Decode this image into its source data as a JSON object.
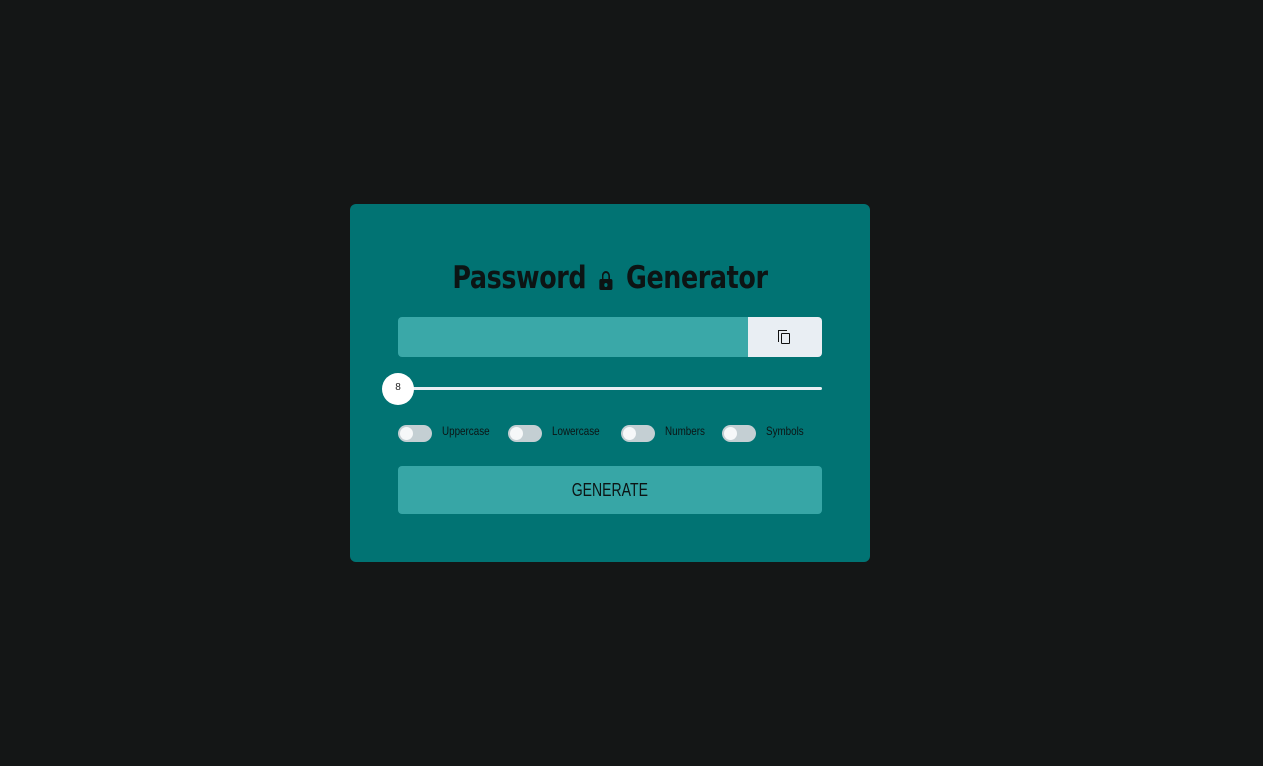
{
  "title": {
    "word1": "Password",
    "word2": "Generator",
    "icon": "lock-icon"
  },
  "password": {
    "value": "",
    "copy_icon": "copy-icon"
  },
  "length_slider": {
    "value": 8
  },
  "options": [
    {
      "label": "Uppercase",
      "checked": false
    },
    {
      "label": "Lowercase",
      "checked": false
    },
    {
      "label": "Numbers",
      "checked": false
    },
    {
      "label": "Symbols",
      "checked": false
    }
  ],
  "generate_button": {
    "label": "GENERATE"
  },
  "colors": {
    "background": "#141616",
    "card": "#017373",
    "input": "#3aa8a8",
    "button": "#37a6a6",
    "copy_button": "#e9eef3"
  }
}
